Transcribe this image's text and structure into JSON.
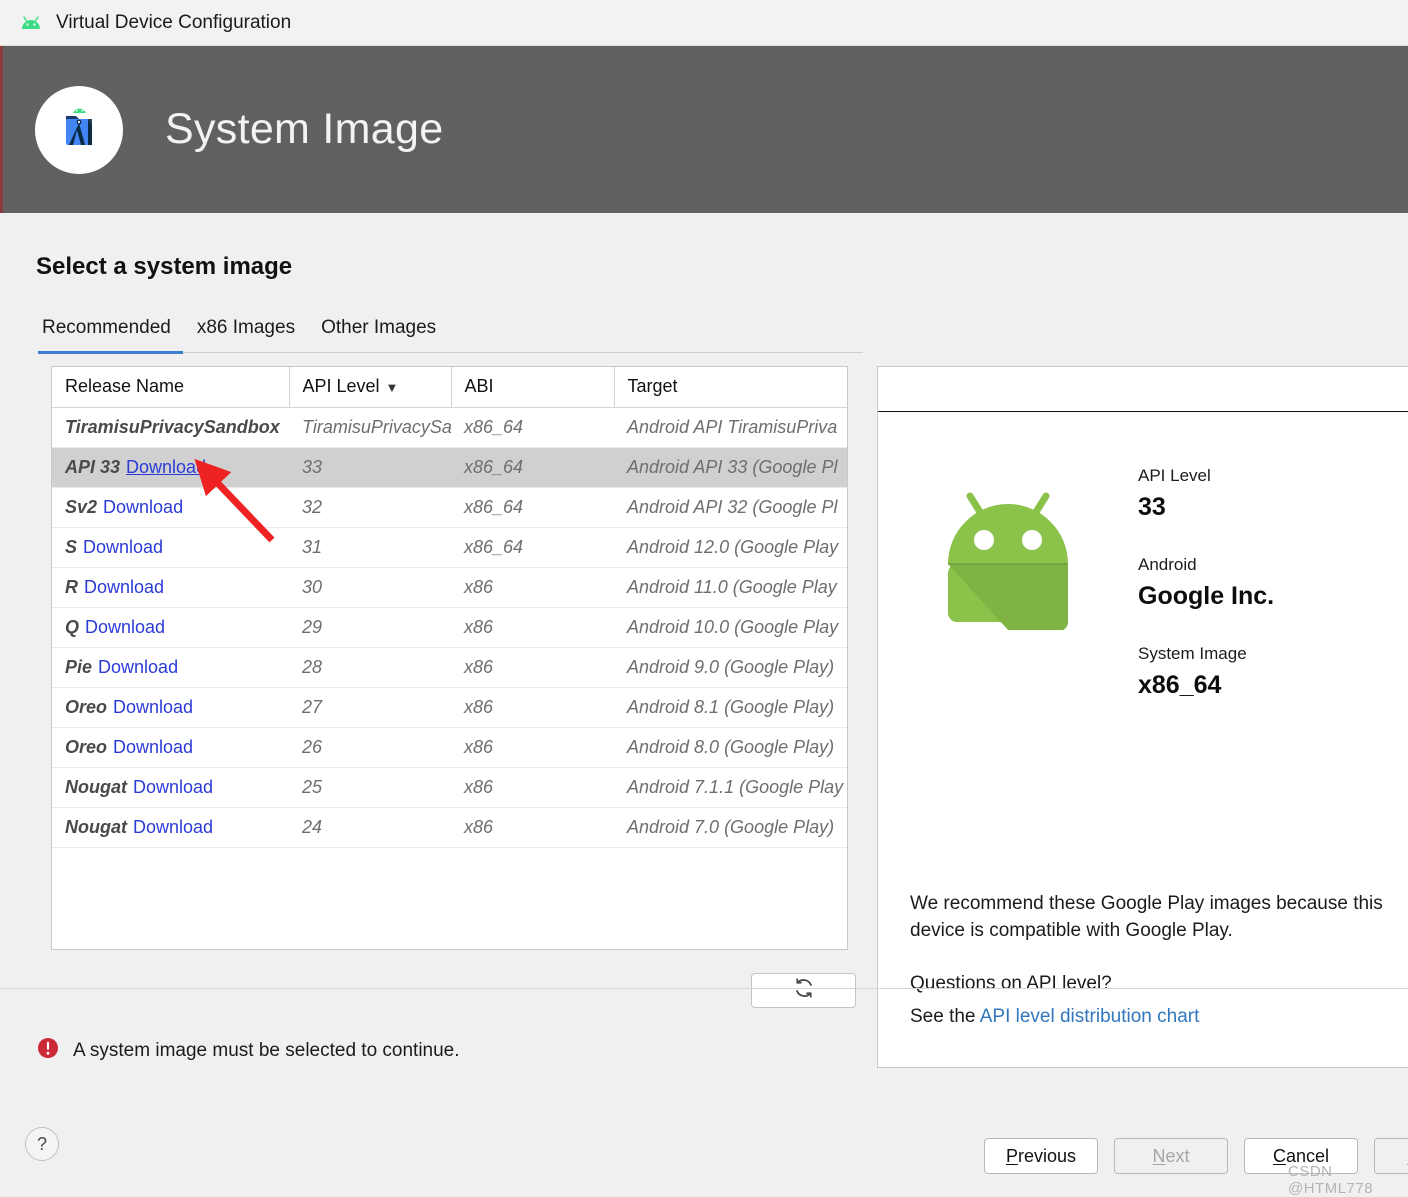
{
  "window": {
    "title": "Virtual Device Configuration",
    "icon": "android-head-icon"
  },
  "header": {
    "title": "System Image",
    "logo_icon": "android-studio-logo"
  },
  "main": {
    "page_title": "Select a system image",
    "tabs": [
      {
        "label": "Recommended",
        "active": true
      },
      {
        "label": "x86 Images",
        "active": false
      },
      {
        "label": "Other Images",
        "active": false
      }
    ],
    "table": {
      "columns": [
        "Release Name",
        "API Level",
        "ABI",
        "Target"
      ],
      "sort_column": "API Level",
      "sort_icon": "caret-down-icon",
      "rows": [
        {
          "name": "TiramisuPrivacySandbox",
          "download": "",
          "api": "TiramisuPrivacySa",
          "abi": "x86_64",
          "target": "Android API TiramisuPriva",
          "selected": false
        },
        {
          "name": "API 33",
          "download": "Download",
          "api": "33",
          "abi": "x86_64",
          "target": "Android API 33 (Google Pl",
          "selected": true
        },
        {
          "name": "Sv2",
          "download": "Download",
          "api": "32",
          "abi": "x86_64",
          "target": "Android API 32 (Google Pl",
          "selected": false
        },
        {
          "name": "S",
          "download": "Download",
          "api": "31",
          "abi": "x86_64",
          "target": "Android 12.0 (Google Play",
          "selected": false
        },
        {
          "name": "R",
          "download": "Download",
          "api": "30",
          "abi": "x86",
          "target": "Android 11.0 (Google Play",
          "selected": false
        },
        {
          "name": "Q",
          "download": "Download",
          "api": "29",
          "abi": "x86",
          "target": "Android 10.0 (Google Play",
          "selected": false
        },
        {
          "name": "Pie",
          "download": "Download",
          "api": "28",
          "abi": "x86",
          "target": "Android 9.0 (Google Play)",
          "selected": false
        },
        {
          "name": "Oreo",
          "download": "Download",
          "api": "27",
          "abi": "x86",
          "target": "Android 8.1 (Google Play)",
          "selected": false
        },
        {
          "name": "Oreo",
          "download": "Download",
          "api": "26",
          "abi": "x86",
          "target": "Android 8.0 (Google Play)",
          "selected": false
        },
        {
          "name": "Nougat",
          "download": "Download",
          "api": "25",
          "abi": "x86",
          "target": "Android 7.1.1 (Google Play",
          "selected": false
        },
        {
          "name": "Nougat",
          "download": "Download",
          "api": "24",
          "abi": "x86",
          "target": "Android 7.0 (Google Play)",
          "selected": false
        }
      ]
    },
    "refresh_button": {
      "icon": "refresh-icon",
      "label": ""
    },
    "validation": {
      "icon": "error-icon",
      "message": "A system image must be selected to continue.",
      "color": "#cc2936"
    }
  },
  "detail": {
    "robot_icon": "android-robot-icon",
    "fields": [
      {
        "label": "API Level",
        "value": "33"
      },
      {
        "label": "Android",
        "value": "Google Inc."
      },
      {
        "label": "System Image",
        "value": "x86_64"
      }
    ],
    "recommendation": "We recommend these Google Play images because this device is compatible with Google Play.",
    "question": "Questions on API level?",
    "see_prefix": "See the ",
    "link_text": "API level distribution chart"
  },
  "footer": {
    "help_label": "?",
    "buttons": [
      {
        "label": "Previous",
        "mnemonic": "P",
        "disabled": false
      },
      {
        "label": "Next",
        "mnemonic": "N",
        "disabled": true
      },
      {
        "label": "Cancel",
        "mnemonic": "C",
        "disabled": false
      },
      {
        "label": "Finish",
        "mnemonic": "F",
        "disabled": true
      }
    ]
  },
  "watermark": "CSDN @HTML778",
  "colors": {
    "header_bg": "#616161",
    "accent": "#3c7fd0",
    "link": "#2b3bd6",
    "error": "#cc2936",
    "selected_row": "#d0d0d0",
    "annotation_arrow": "#ee2222"
  }
}
